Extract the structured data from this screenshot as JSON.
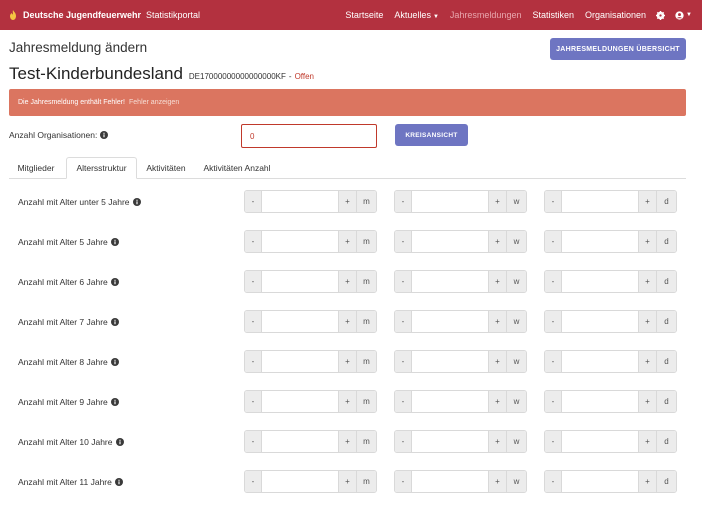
{
  "navbar": {
    "brand": "Deutsche Jugendfeuerwehr",
    "portal": "Statistikportal",
    "links": [
      {
        "label": "Startseite"
      },
      {
        "label": "Aktuelles",
        "dropdown": true
      },
      {
        "label": "Jahresmeldungen",
        "active": true
      },
      {
        "label": "Statistiken"
      },
      {
        "label": "Organisationen"
      }
    ],
    "icons": [
      "gear-icon",
      "user-icon"
    ]
  },
  "header": {
    "title": "Jahresmeldung ändern",
    "overview_button": "JAHRESMELDUNGEN ÜBERSICHT",
    "subtitle": "Test-Kinderbundesland",
    "meldung_id": "DE17000000000000000KF",
    "separator": "-",
    "status": "Offen"
  },
  "alert": {
    "message": "Die Jahresmeldung enthält Fehler!",
    "link": "Fehler anzeigen"
  },
  "org": {
    "label": "Anzahl Organisationen:",
    "value": "0",
    "kreis_button": "KREISANSICHT"
  },
  "tabs": [
    {
      "label": "Mitglieder"
    },
    {
      "label": "Altersstruktur",
      "active": true
    },
    {
      "label": "Aktivitäten"
    },
    {
      "label": "Aktivitäten Anzahl"
    }
  ],
  "stepper": {
    "minus": "-",
    "plus": "+",
    "units": [
      "m",
      "w",
      "d"
    ]
  },
  "rows": [
    {
      "label": "Anzahl mit Alter unter 5 Jahre"
    },
    {
      "label": "Anzahl mit Alter 5 Jahre"
    },
    {
      "label": "Anzahl mit Alter 6 Jahre"
    },
    {
      "label": "Anzahl mit Alter 7 Jahre"
    },
    {
      "label": "Anzahl mit Alter 8 Jahre"
    },
    {
      "label": "Anzahl mit Alter 9 Jahre"
    },
    {
      "label": "Anzahl mit Alter 10 Jahre"
    },
    {
      "label": "Anzahl mit Alter 11 Jahre"
    }
  ],
  "colors": {
    "navbar": "#b3313f",
    "button": "#6e75c2",
    "alert": "#db7560",
    "error": "#c0392b"
  }
}
